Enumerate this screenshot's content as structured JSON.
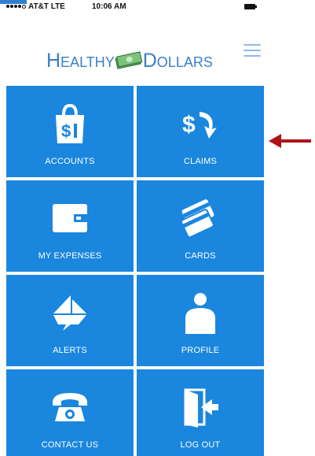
{
  "status_bar": {
    "carrier": "AT&T  LTE",
    "time": "10:06 AM"
  },
  "header": {
    "logo_text_left": "Healthy",
    "logo_text_right": "Dollars",
    "menu_icon": "hamburger-menu-icon"
  },
  "tiles": [
    {
      "label": "ACCOUNTS",
      "icon": "shopping-bag-dollar-icon"
    },
    {
      "label": "CLAIMS",
      "icon": "dollar-arrow-icon"
    },
    {
      "label": "MY EXPENSES",
      "icon": "wallet-icon"
    },
    {
      "label": "CARDS",
      "icon": "cards-icon"
    },
    {
      "label": "ALERTS",
      "icon": "paper-plane-icon"
    },
    {
      "label": "PROFILE",
      "icon": "person-icon"
    },
    {
      "label": "CONTACT US",
      "icon": "telephone-icon"
    },
    {
      "label": "LOG OUT",
      "icon": "logout-door-icon"
    }
  ],
  "colors": {
    "tile_blue": "#1a86de",
    "logo_blue": "#3a7fc6",
    "annotation_arrow": "#b01218"
  }
}
